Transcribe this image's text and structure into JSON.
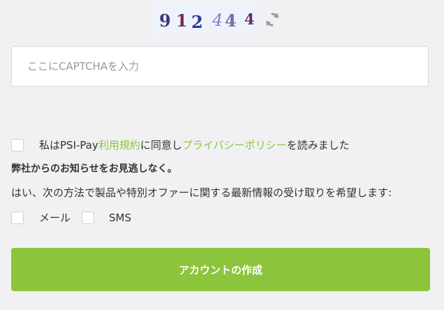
{
  "captcha": {
    "characters": [
      {
        "char": "9",
        "color": "#3a3a7a"
      },
      {
        "char": "1",
        "color": "#7b2a5a"
      },
      {
        "char": "2",
        "color": "#2a3a8a"
      },
      {
        "char": "4",
        "color": "#8a7ad0"
      },
      {
        "char": "4",
        "color": "#7a6aa0"
      },
      {
        "char": "4",
        "color": "#6a2a6a"
      }
    ],
    "refresh_icon": "refresh-icon",
    "input_placeholder": "ここにCAPTCHAを入力",
    "input_value": ""
  },
  "terms": {
    "prefix": "私はPSI-Pay",
    "terms_link": "利用規約",
    "middle": "に同意し",
    "privacy_link": "プライバシーポリシー",
    "suffix": "を読みました",
    "checked": false
  },
  "marketing": {
    "heading": "弊社からのお知らせをお見逃しなく。",
    "description": "はい、次の方法で製品や特別オファーに関する最新情報の受け取りを希望します:",
    "options": [
      {
        "label": "メール",
        "checked": false
      },
      {
        "label": "SMS",
        "checked": false
      }
    ]
  },
  "submit": {
    "label": "アカウントの作成"
  },
  "colors": {
    "accent": "#8cc43c",
    "background": "#f1f1f3"
  }
}
